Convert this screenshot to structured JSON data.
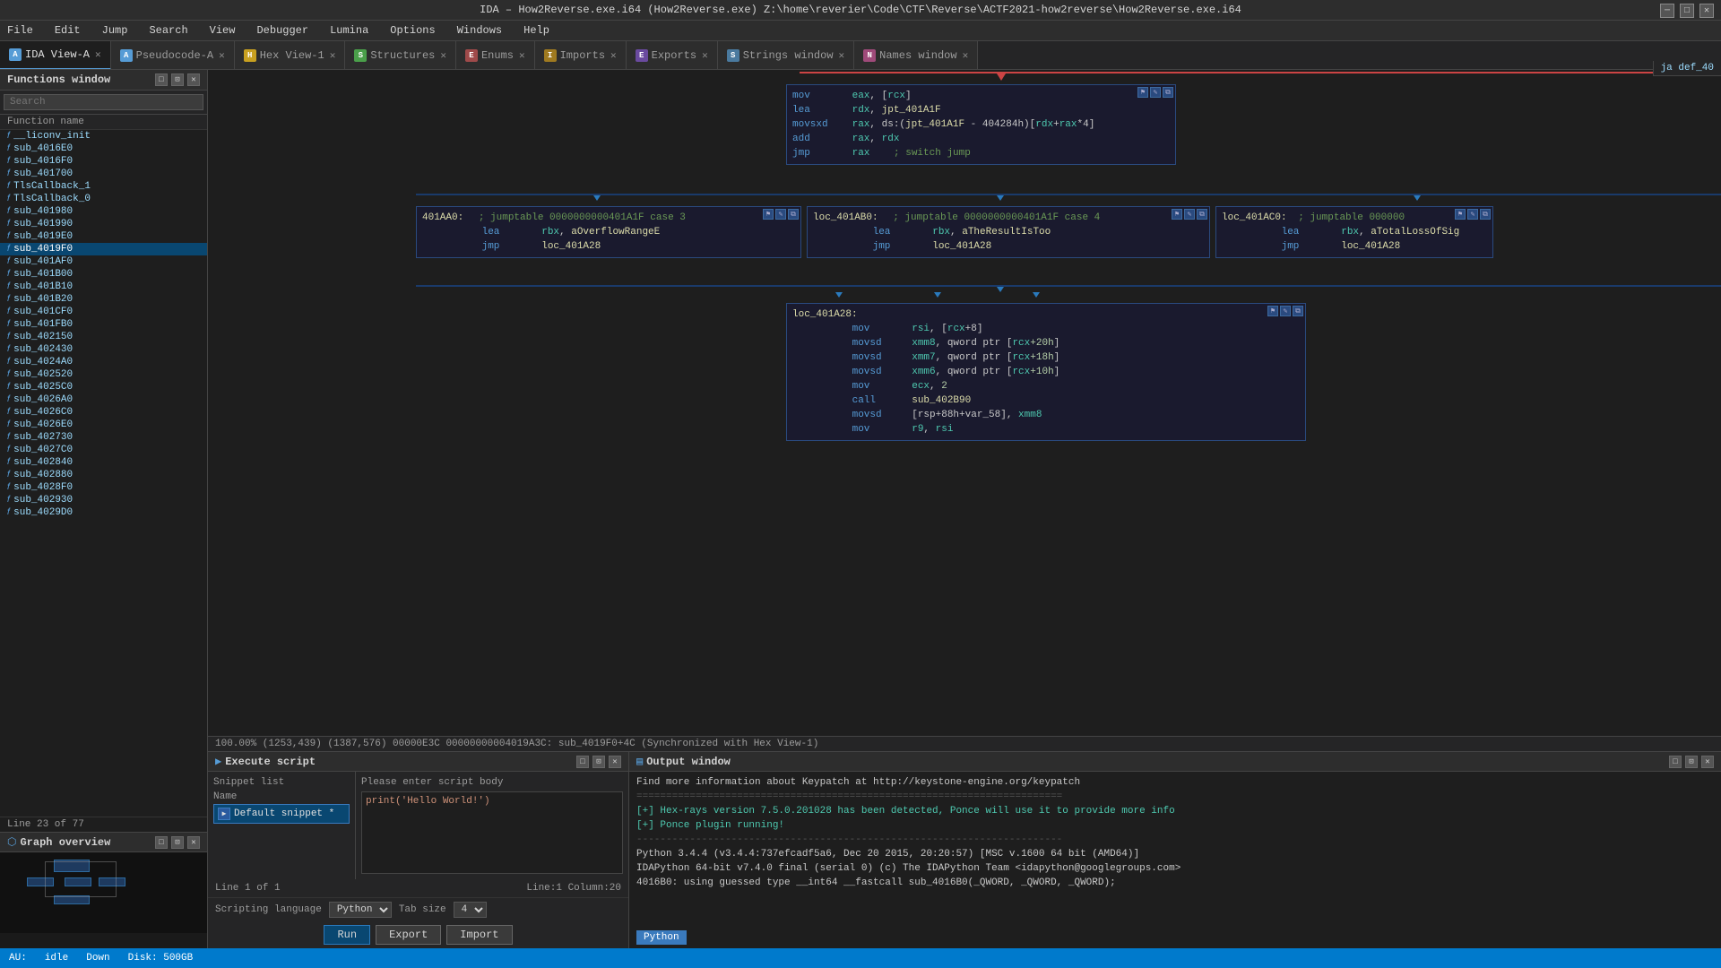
{
  "title_bar": {
    "text": "IDA – How2Reverse.exe.i64 (How2Reverse.exe)  Z:\\home\\reverier\\Code\\CTF\\Reverse\\ACTF2021-how2reverse\\How2Reverse.exe.i64"
  },
  "menu": {
    "items": [
      "File",
      "Edit",
      "Jump",
      "Search",
      "View",
      "Debugger",
      "Lumina",
      "Options",
      "Windows",
      "Help"
    ]
  },
  "tabs": [
    {
      "id": "ida-view-a",
      "label": "IDA View-A",
      "active": true,
      "icon": "A"
    },
    {
      "id": "pseudocode-a",
      "label": "Pseudocode-A",
      "active": false,
      "icon": "A"
    },
    {
      "id": "hex-view-1",
      "label": "Hex View-1",
      "active": false,
      "icon": "H"
    },
    {
      "id": "structures",
      "label": "Structures",
      "active": false,
      "icon": "S"
    },
    {
      "id": "enums",
      "label": "Enums",
      "active": false,
      "icon": "E"
    },
    {
      "id": "imports",
      "label": "Imports",
      "active": false,
      "icon": "I"
    },
    {
      "id": "exports",
      "label": "Exports",
      "active": false,
      "icon": "E"
    },
    {
      "id": "strings-window",
      "label": "Strings window",
      "active": false,
      "icon": "S"
    },
    {
      "id": "names-window",
      "label": "Names window",
      "active": false,
      "icon": "N"
    }
  ],
  "functions_panel": {
    "title": "Functions window",
    "col_header": "Function name",
    "items": [
      {
        "name": "__liconv_init",
        "selected": false
      },
      {
        "name": "sub_4016E0",
        "selected": false
      },
      {
        "name": "sub_4016F0",
        "selected": false
      },
      {
        "name": "sub_401700",
        "selected": false
      },
      {
        "name": "TlsCallback_1",
        "selected": false
      },
      {
        "name": "TlsCallback_0",
        "selected": false
      },
      {
        "name": "sub_401980",
        "selected": false
      },
      {
        "name": "sub_401990",
        "selected": false
      },
      {
        "name": "sub_4019E0",
        "selected": false
      },
      {
        "name": "sub_4019F0",
        "selected": true
      },
      {
        "name": "sub_401AF0",
        "selected": false
      },
      {
        "name": "sub_401B00",
        "selected": false
      },
      {
        "name": "sub_401B10",
        "selected": false
      },
      {
        "name": "sub_401B20",
        "selected": false
      },
      {
        "name": "sub_401CF0",
        "selected": false
      },
      {
        "name": "sub_401FB0",
        "selected": false
      },
      {
        "name": "sub_402150",
        "selected": false
      },
      {
        "name": "sub_402430",
        "selected": false
      },
      {
        "name": "sub_4024A0",
        "selected": false
      },
      {
        "name": "sub_402520",
        "selected": false
      },
      {
        "name": "sub_4025C0",
        "selected": false
      },
      {
        "name": "sub_4026A0",
        "selected": false
      },
      {
        "name": "sub_4026C0",
        "selected": false
      },
      {
        "name": "sub_4026E0",
        "selected": false
      },
      {
        "name": "sub_402730",
        "selected": false
      },
      {
        "name": "sub_4027C0",
        "selected": false
      },
      {
        "name": "sub_402840",
        "selected": false
      },
      {
        "name": "sub_402880",
        "selected": false
      },
      {
        "name": "sub_4028F0",
        "selected": false
      },
      {
        "name": "sub_402930",
        "selected": false
      },
      {
        "name": "sub_4029D0",
        "selected": false
      }
    ],
    "footer": "Line 23 of 77"
  },
  "graph_overview": {
    "title": "Graph overview"
  },
  "code_blocks": {
    "block1": {
      "lines": [
        {
          "addr": "",
          "mnemonic": "mov",
          "op1": "eax,",
          "op2": "[rcx]",
          "comment": ""
        },
        {
          "addr": "",
          "mnemonic": "lea",
          "op1": "rdx,",
          "op2": "jpt_401A1F",
          "comment": ""
        },
        {
          "addr": "",
          "mnemonic": "movsxd",
          "op1": "rax,",
          "op2": "ds:(jpt_401A1F - 404284h)[rdx+rax*4]",
          "comment": ""
        },
        {
          "addr": "",
          "mnemonic": "add",
          "op1": "rax,",
          "op2": "rdx",
          "comment": ""
        },
        {
          "addr": "",
          "mnemonic": "jmp",
          "op1": "rax",
          "op2": "",
          "comment": "; switch jump"
        }
      ]
    },
    "block2": {
      "label": "401AA0:",
      "comment": "; jumptable 0000000000401A1F case 3",
      "lines": [
        {
          "mnemonic": "lea",
          "op": "rbx, aOverflowRangeE"
        },
        {
          "mnemonic": "jmp",
          "op": "loc_401A28"
        }
      ]
    },
    "block3": {
      "label": "loc_401AB0:",
      "comment": "; jumptable 0000000000401A1F case 4",
      "lines": [
        {
          "mnemonic": "lea",
          "op": "rbx, aTheResultIsToo"
        },
        {
          "mnemonic": "jmp",
          "op": "loc_401A28"
        }
      ]
    },
    "block4": {
      "label": "loc_401AC0:",
      "comment": "; jumptable 000000",
      "lines": [
        {
          "mnemonic": "lea",
          "op": "rbx, aTotalLossOfSig"
        },
        {
          "mnemonic": "jmp",
          "op": "loc_401A28"
        }
      ]
    },
    "block5": {
      "label": "loc_401A28:",
      "lines": [
        {
          "mnemonic": "mov",
          "op": "rsi, [rcx+8]"
        },
        {
          "mnemonic": "movsd",
          "op": "xmm8, qword ptr [rcx+20h]"
        },
        {
          "mnemonic": "movsd",
          "op": "xmm7, qword ptr [rcx+18h]"
        },
        {
          "mnemonic": "movsd",
          "op": "xmm6, qword ptr [rcx+10h]"
        },
        {
          "mnemonic": "mov",
          "op": "ecx, 2"
        },
        {
          "mnemonic": "call",
          "op": "sub_402B90"
        },
        {
          "mnemonic": "movsd",
          "op": "[rsp+88h+var_58], xmm8"
        },
        {
          "mnemonic": "mov",
          "op": "r9, rsi"
        }
      ]
    }
  },
  "status_bar_bottom": {
    "text": "100.00% (1253,439) (1387,576) 00000E3C 00000000004019A3C: sub_4019F0+4C (Synchronized with Hex View-1)"
  },
  "execute_script": {
    "title": "Execute script",
    "snippet_list_header": "Snippet list",
    "name_col": "Name",
    "selected_snippet": "Default snippet *",
    "script_body_header": "Please enter script body",
    "script_content": "print('Hello World!')",
    "line_info": "Line 1 of 1",
    "position_info": "Line:1  Column:20",
    "scripting_lang_label": "Scripting language",
    "lang": "Python",
    "tab_size_label": "Tab size",
    "tab_size": "4",
    "btn_run": "Run",
    "btn_export": "Export",
    "btn_import": "Import"
  },
  "output_window": {
    "title": "Output window",
    "lines": [
      "Find more information about Keypatch at http://keystone-engine.org/keypatch",
      "========================================================================",
      "[+] Hex-rays version 7.5.0.201028 has been detected, Ponce will use it to provide more info",
      "[+] Ponce plugin running!",
      "------------------------------------------------------------------------",
      "Python 3.4.4 (v3.4.4:737efcadf5a6, Dec 20 2015, 20:20:57) [MSC v.1600 64 bit (AMD64)]",
      "IDAPython 64-bit v7.4.0 final (serial 0) (c) The IDAPython Team <idapython@googlegroups.com>",
      "",
      "4016B0: using guessed type __int64 __fastcall sub_4016B0(_QWORD, _QWORD, _QWORD);"
    ],
    "python_badge": "Python"
  },
  "top_address_bar": {
    "text": "ja      def_40"
  },
  "search_label": "Search",
  "strings_window_label": "Strings window",
  "names_window_label": "Names window"
}
